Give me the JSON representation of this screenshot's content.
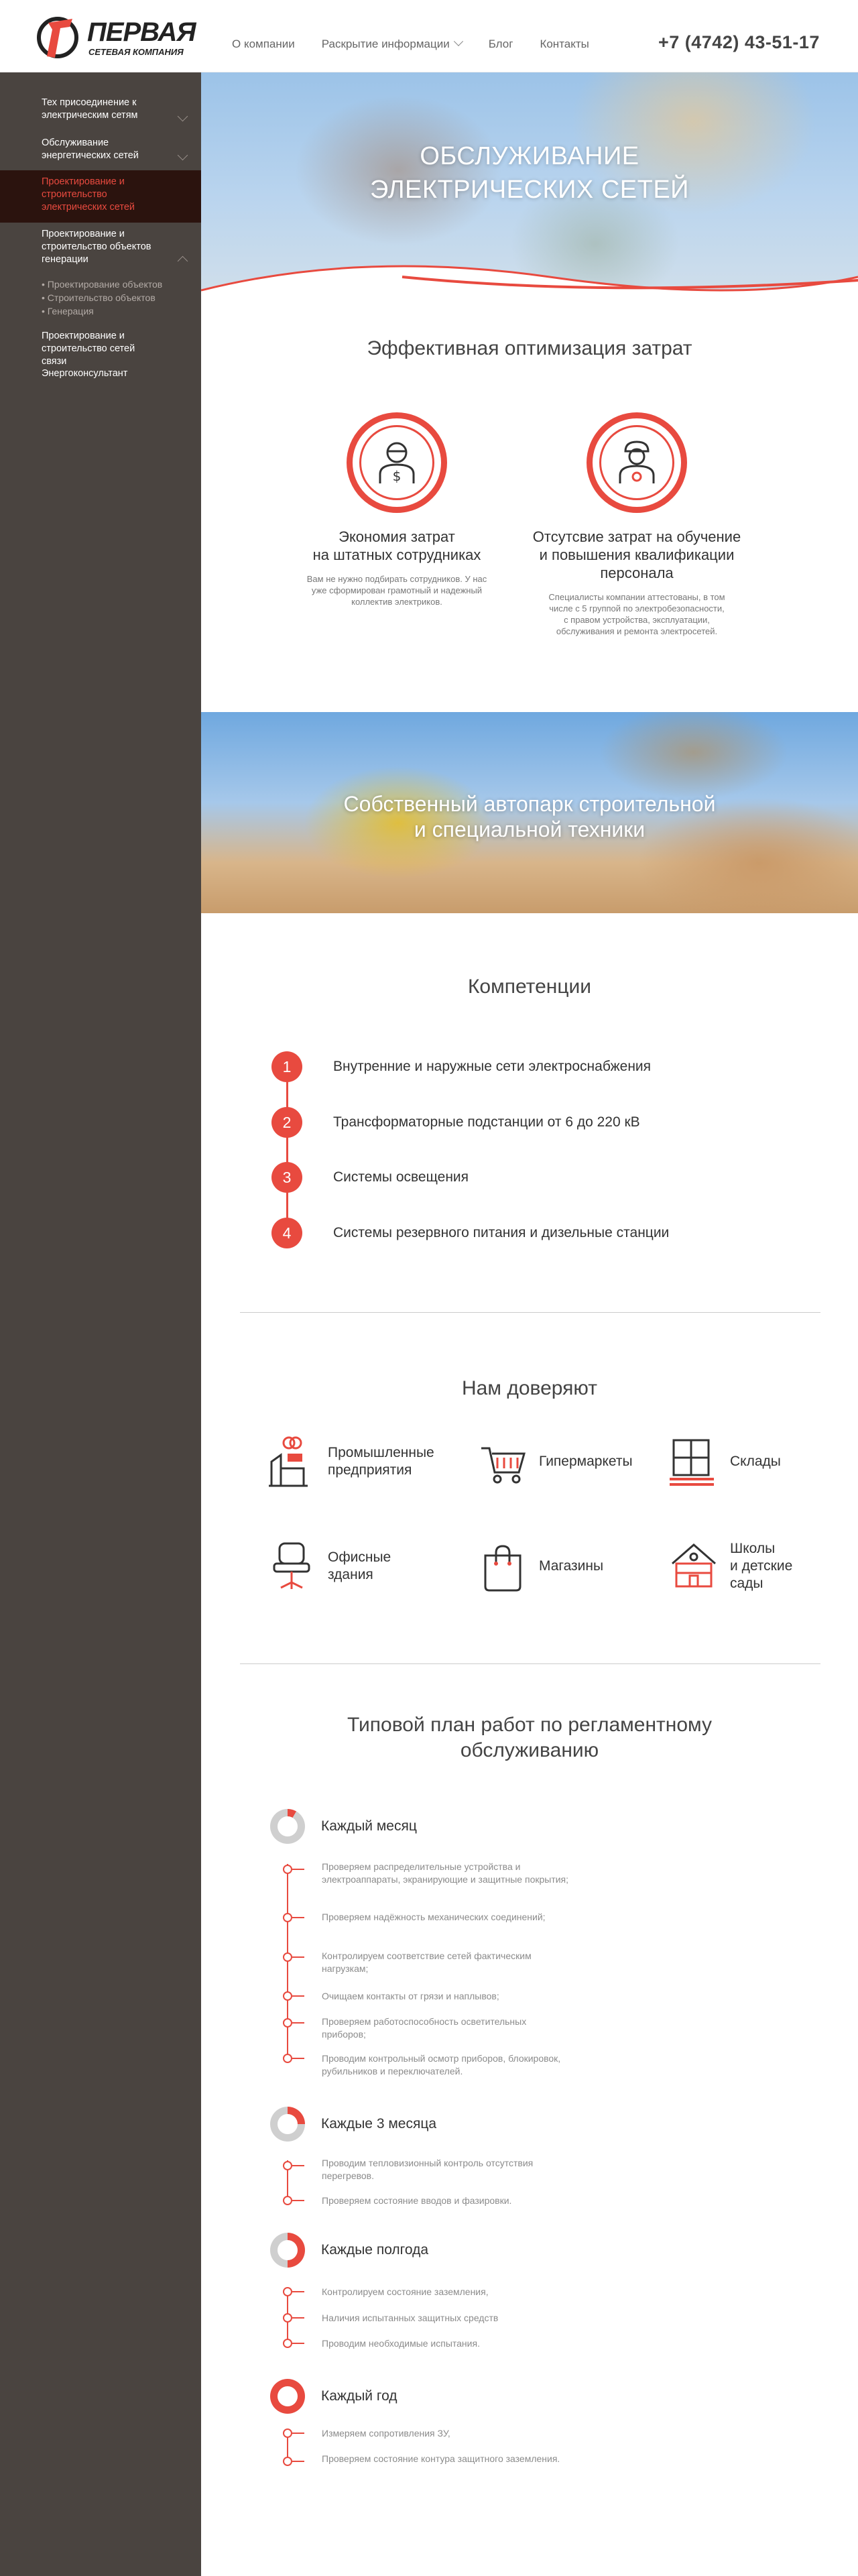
{
  "header": {
    "logo": {
      "title": "ПЕРВАЯ",
      "subtitle": "СЕТЕВАЯ КОМПАНИЯ"
    },
    "nav": [
      {
        "label": "О компании"
      },
      {
        "label": "Раскрытие информации"
      },
      {
        "label": "Блог"
      },
      {
        "label": "Контакты"
      }
    ],
    "phone": "+7 (4742) 43-51-17"
  },
  "sidebar": {
    "items": [
      {
        "label": "Тех присоединение к электрическим сетям"
      },
      {
        "label": "Обслуживание энергетических сетей"
      },
      {
        "label": "Проектирование и строительство электрических сетей"
      },
      {
        "label": "Проектирование и строительство объектов генерации"
      },
      {
        "label": "Проектирование и строительство сетей связи"
      },
      {
        "label": "Энергоконсультант"
      }
    ],
    "subitems": [
      "• Проектирование объектов",
      "• Строительство объектов",
      "• Генерация"
    ]
  },
  "hero": {
    "title_line1": "ОБСЛУЖИВАНИЕ",
    "title_line2": "ЭЛЕКТРИЧЕСКИХ СЕТЕЙ"
  },
  "optimization": {
    "title": "Эффективная оптимизация затрат",
    "features": [
      {
        "title_line1": "Экономия затрат",
        "title_line2": "на штатных сотрудниках",
        "text": "Вам не нужно подбирать сотрудников. У нас уже сформирован грамотный и надежный коллектив электриков.",
        "icon": "money-worker-icon"
      },
      {
        "title_line1": "Отсутсвие затрат на обучение",
        "title_line2": "и повышения квалификации",
        "title_line3": "персонала",
        "text": "Специалисты компании аттестованы, в том числе с 5 группой по электробезопасности, с правом устройства, эксплуатации, обслуживания и ремонта электросетей.",
        "icon": "certified-worker-icon"
      }
    ]
  },
  "machinery": {
    "title_line1": "Собственный автопарк строительной",
    "title_line2": "и специальной техники"
  },
  "competencies": {
    "title": "Компетенции",
    "items": [
      {
        "num": "1",
        "text": "Внутренние и наружные сети электроснабжения"
      },
      {
        "num": "2",
        "text": "Трансформаторные подстанции от 6 до 220 кВ"
      },
      {
        "num": "3",
        "text": "Системы освещения"
      },
      {
        "num": "4",
        "text": "Системы резервного питания и дизельные станции"
      }
    ]
  },
  "trust": {
    "title": "Нам доверяют",
    "items": [
      {
        "line1": "Промышленные",
        "line2": "предприятия",
        "icon": "factory-icon"
      },
      {
        "line1": "Гипермаркеты",
        "line2": "",
        "icon": "shopping-cart-icon"
      },
      {
        "line1": "Склады",
        "line2": "",
        "icon": "warehouse-boxes-icon"
      },
      {
        "line1": "Офисные",
        "line2": "здания",
        "icon": "office-chair-icon"
      },
      {
        "line1": "Магазины",
        "line2": "",
        "icon": "shopping-bag-icon"
      },
      {
        "line1": "Школы",
        "line2": "и детские",
        "line3": "сады",
        "icon": "school-icon"
      }
    ]
  },
  "plan": {
    "title_line1": "Типовой план работ по регламентному",
    "title_line2": "обслуживанию",
    "periods": [
      {
        "label": "Каждый месяц",
        "fill": 0.083,
        "tasks": [
          "Проверяем распределительные устройства и электроаппараты, экранирующие и защитные покрытия;",
          "Проверяем надёжность механических соединений;",
          "Контролируем соответствие сетей фактическим нагрузкам;",
          "Очищаем контакты от грязи и наплывов;",
          "Проверяем работоспособность осветительных приборов;",
          "Проводим контрольный осмотр приборов, блокировок, рубильников и переключателей."
        ]
      },
      {
        "label": "Каждые 3 месяца",
        "fill": 0.25,
        "tasks": [
          "Проводим тепловизионный контроль отсутствия перегревов.",
          "Проверяем состояние вводов и фазировки."
        ]
      },
      {
        "label": "Каждые полгода",
        "fill": 0.5,
        "tasks": [
          "Контролируем состояние заземления,",
          "Наличия испытанных защитных средств",
          "Проводим необходимые испытания."
        ]
      },
      {
        "label": "Каждый год",
        "fill": 1.0,
        "tasks": [
          "Измеряем сопротивления ЗУ,",
          "Проверяем состояние контура защитного заземления."
        ]
      }
    ]
  },
  "colors": {
    "accent": "#e84a3f",
    "sidebar": "#4a4440",
    "sidebar_active": "#2b130e"
  }
}
